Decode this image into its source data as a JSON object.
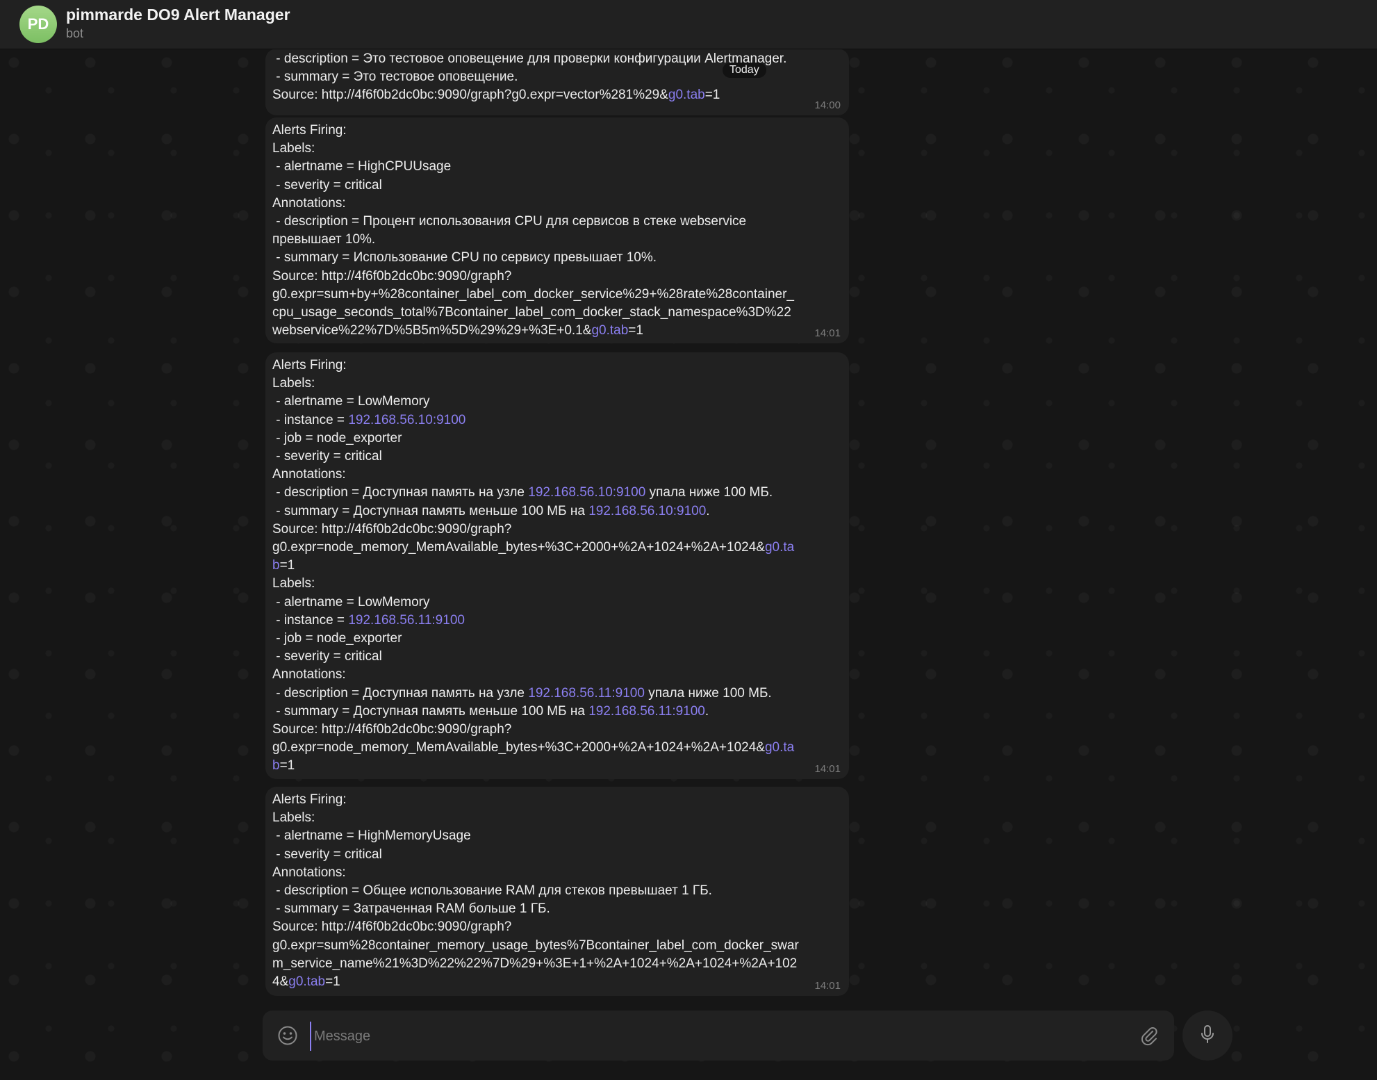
{
  "header": {
    "avatar_initials": "PD",
    "title": "pimmarde DO9 Alert Manager",
    "subtitle": "bot"
  },
  "date_badge": "Today",
  "messages": [
    {
      "time": "14:00",
      "lines": [
        [
          {
            "t": " - description = Это тестовое оповещение для проверки конфигурации Alertmanager."
          }
        ],
        [
          {
            "t": " - summary = Это тестовое оповещение."
          }
        ],
        [
          {
            "t": "Source: http://4f6f0b2dc0bc:9090/graph?g0.expr=vector%281%29&"
          },
          {
            "t": "g0.tab",
            "link": true
          },
          {
            "t": "=1"
          }
        ]
      ]
    },
    {
      "time": "14:01",
      "lines": [
        [
          {
            "t": "Alerts Firing:"
          }
        ],
        [
          {
            "t": "Labels:"
          }
        ],
        [
          {
            "t": " - alertname = HighCPUUsage"
          }
        ],
        [
          {
            "t": " - severity = critical"
          }
        ],
        [
          {
            "t": "Annotations:"
          }
        ],
        [
          {
            "t": " - description = Процент использования CPU для сервисов в стеке webservice"
          }
        ],
        [
          {
            "t": "превышает 10%."
          }
        ],
        [
          {
            "t": " - summary = Использование CPU по сервису превышает 10%."
          }
        ],
        [
          {
            "t": "Source: http://4f6f0b2dc0bc:9090/graph?"
          }
        ],
        [
          {
            "t": "g0.expr=sum+by+%28container_label_com_docker_service%29+%28rate%28container_"
          }
        ],
        [
          {
            "t": "cpu_usage_seconds_total%7Bcontainer_label_com_docker_stack_namespace%3D%22"
          }
        ],
        [
          {
            "t": "webservice%22%7D%5B5m%5D%29%29+%3E+0.1&"
          },
          {
            "t": "g0.tab",
            "link": true
          },
          {
            "t": "=1"
          }
        ]
      ]
    },
    {
      "time": "14:01",
      "lines": [
        [
          {
            "t": "Alerts Firing:"
          }
        ],
        [
          {
            "t": "Labels:"
          }
        ],
        [
          {
            "t": " - alertname = LowMemory"
          }
        ],
        [
          {
            "t": " - instance = "
          },
          {
            "t": "192.168.56.10:9100",
            "link": true
          }
        ],
        [
          {
            "t": " - job = node_exporter"
          }
        ],
        [
          {
            "t": " - severity = critical"
          }
        ],
        [
          {
            "t": "Annotations:"
          }
        ],
        [
          {
            "t": " - description = Доступная память на узле "
          },
          {
            "t": "192.168.56.10:9100",
            "link": true
          },
          {
            "t": " упала ниже 100 МБ."
          }
        ],
        [
          {
            "t": " - summary = Доступная память меньше 100 МБ на "
          },
          {
            "t": "192.168.56.10:9100",
            "link": true
          },
          {
            "t": "."
          }
        ],
        [
          {
            "t": "Source: http://4f6f0b2dc0bc:9090/graph?"
          }
        ],
        [
          {
            "t": "g0.expr=node_memory_MemAvailable_bytes+%3C+2000+%2A+1024+%2A+1024&"
          },
          {
            "t": "g0.ta",
            "link": true
          }
        ],
        [
          {
            "t": "b",
            "link": true
          },
          {
            "t": "=1"
          }
        ],
        [
          {
            "t": "Labels:"
          }
        ],
        [
          {
            "t": " - alertname = LowMemory"
          }
        ],
        [
          {
            "t": " - instance = "
          },
          {
            "t": "192.168.56.11:9100",
            "link": true
          }
        ],
        [
          {
            "t": " - job = node_exporter"
          }
        ],
        [
          {
            "t": " - severity = critical"
          }
        ],
        [
          {
            "t": "Annotations:"
          }
        ],
        [
          {
            "t": " - description = Доступная память на узле "
          },
          {
            "t": "192.168.56.11:9100",
            "link": true
          },
          {
            "t": " упала ниже 100 МБ."
          }
        ],
        [
          {
            "t": " - summary = Доступная память меньше 100 МБ на "
          },
          {
            "t": "192.168.56.11:9100",
            "link": true
          },
          {
            "t": "."
          }
        ],
        [
          {
            "t": "Source: http://4f6f0b2dc0bc:9090/graph?"
          }
        ],
        [
          {
            "t": "g0.expr=node_memory_MemAvailable_bytes+%3C+2000+%2A+1024+%2A+1024&"
          },
          {
            "t": "g0.ta",
            "link": true
          }
        ],
        [
          {
            "t": "b",
            "link": true
          },
          {
            "t": "=1"
          }
        ]
      ]
    },
    {
      "time": "14:01",
      "lines": [
        [
          {
            "t": "Alerts Firing:"
          }
        ],
        [
          {
            "t": "Labels:"
          }
        ],
        [
          {
            "t": " - alertname = HighMemoryUsage"
          }
        ],
        [
          {
            "t": " - severity = critical"
          }
        ],
        [
          {
            "t": "Annotations:"
          }
        ],
        [
          {
            "t": " - description = Общее использование RAM для стеков превышает 1 ГБ."
          }
        ],
        [
          {
            "t": " - summary = Затраченная RAM больше 1 ГБ."
          }
        ],
        [
          {
            "t": "Source: http://4f6f0b2dc0bc:9090/graph?"
          }
        ],
        [
          {
            "t": "g0.expr=sum%28container_memory_usage_bytes%7Bcontainer_label_com_docker_swar"
          }
        ],
        [
          {
            "t": "m_service_name%21%3D%22%22%7D%29+%3E+1+%2A+1024+%2A+1024+%2A+102"
          }
        ],
        [
          {
            "t": "4&"
          },
          {
            "t": "g0.tab",
            "link": true
          },
          {
            "t": "=1"
          }
        ]
      ]
    }
  ],
  "composer": {
    "placeholder": "Message",
    "value": ""
  },
  "icons": {
    "emoji": "smile-icon",
    "attach": "paperclip-icon",
    "mic": "microphone-icon"
  }
}
